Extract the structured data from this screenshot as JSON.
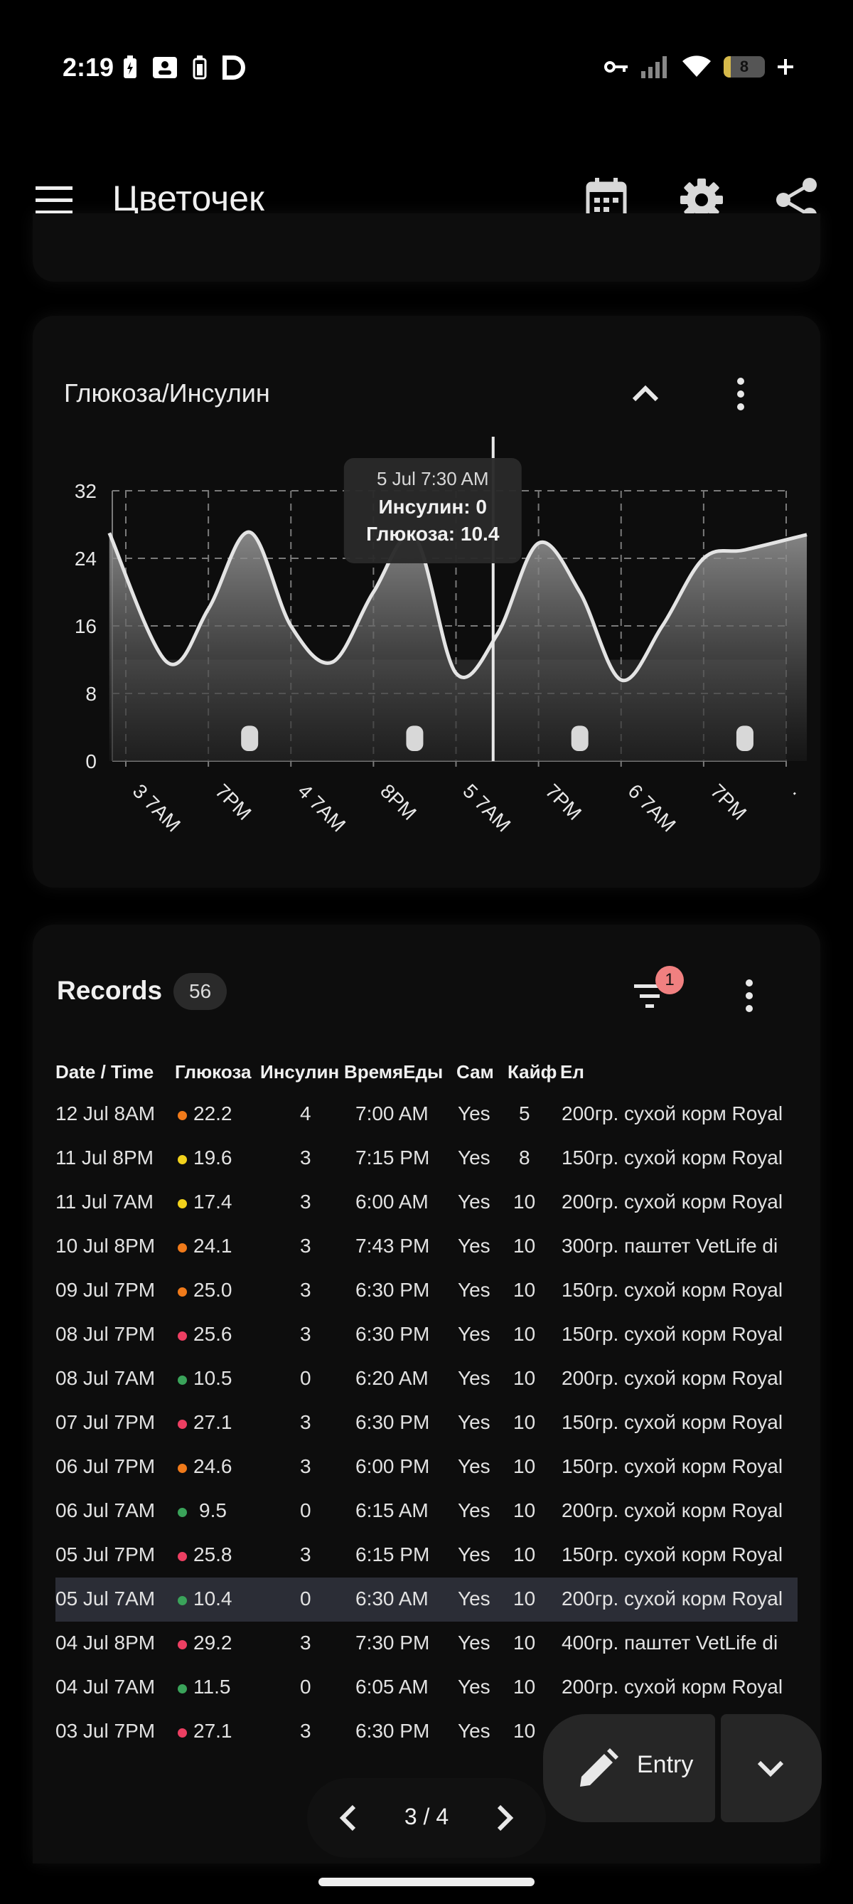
{
  "status": {
    "time": "2:19",
    "battery": "8",
    "battery_level": 0.08
  },
  "appbar": {
    "title": "Цветочек"
  },
  "chart_card": {
    "title": "Глюкоза/Инсулин",
    "tooltip": {
      "date": "5 Jul 7:30 AM",
      "insulin": "Инсулин: 0",
      "glucose": "Глюкоза: 10.4"
    }
  },
  "chart_data": {
    "type": "area",
    "ylim": [
      0,
      32
    ],
    "y_ticks": [
      "0",
      "8",
      "16",
      "24",
      "32"
    ],
    "x_ticks": [
      "3 7AM",
      "7PM",
      "4 7AM",
      "8PM",
      "5 7AM",
      "7PM",
      "6 7AM",
      "7PM",
      "."
    ],
    "x_tick_positions": [
      0,
      1,
      2,
      3,
      4,
      5,
      6,
      7,
      8
    ],
    "xlim": [
      -0.2,
      8.25
    ],
    "target_range": [
      0,
      12
    ],
    "series": [
      {
        "type": "area",
        "x": [
          -0.2,
          0.5,
          1.0,
          1.5,
          2.0,
          2.5,
          3.0,
          3.5,
          4.0,
          4.5,
          5.0,
          5.5,
          6.0,
          6.5,
          7.0,
          7.5,
          8.25
        ],
        "values": [
          27.0,
          11.7,
          18.0,
          27.1,
          16.0,
          11.7,
          20.0,
          26.5,
          10.4,
          15.0,
          25.8,
          20.0,
          9.6,
          16.0,
          24.0,
          25.0,
          26.8
        ]
      },
      {
        "type": "bar",
        "x": [
          1.5,
          3.5,
          5.5,
          7.5
        ],
        "values": [
          3,
          3,
          3,
          3
        ]
      }
    ],
    "cursor_x": 4.45
  },
  "records": {
    "title": "Records",
    "count": "56",
    "filter_badge": "1",
    "columns": [
      "Date / Time",
      "Глюкоза",
      "Инсулин",
      "ВремяЕды",
      "Сам",
      "Кайф",
      "Ел"
    ],
    "rows": [
      {
        "date": "12 Jul 8AM",
        "glucose": "22.2",
        "dot": "#f07a1a",
        "insulin": "4",
        "meal": "7:00 AM",
        "self": "Yes",
        "joy": "5",
        "food": "200гр. сухой корм Royal"
      },
      {
        "date": "11 Jul 8PM",
        "glucose": "19.6",
        "dot": "#f2d21c",
        "insulin": "3",
        "meal": "7:15 PM",
        "self": "Yes",
        "joy": "8",
        "food": "150гр. сухой корм Royal"
      },
      {
        "date": "11 Jul 7AM",
        "glucose": "17.4",
        "dot": "#f2d21c",
        "insulin": "3",
        "meal": "6:00 AM",
        "self": "Yes",
        "joy": "10",
        "food": "200гр. сухой корм Royal"
      },
      {
        "date": "10 Jul 8PM",
        "glucose": "24.1",
        "dot": "#f07a1a",
        "insulin": "3",
        "meal": "7:43 PM",
        "self": "Yes",
        "joy": "10",
        "food": "300гр. паштет VetLife di"
      },
      {
        "date": "09 Jul 7PM",
        "glucose": "25.0",
        "dot": "#f07a1a",
        "insulin": "3",
        "meal": "6:30 PM",
        "self": "Yes",
        "joy": "10",
        "food": "150гр. сухой корм Royal"
      },
      {
        "date": "08 Jul 7PM",
        "glucose": "25.6",
        "dot": "#ec3f62",
        "insulin": "3",
        "meal": "6:30 PM",
        "self": "Yes",
        "joy": "10",
        "food": "150гр. сухой корм Royal"
      },
      {
        "date": "08 Jul 7AM",
        "glucose": "10.5",
        "dot": "#3aa35a",
        "insulin": "0",
        "meal": "6:20 AM",
        "self": "Yes",
        "joy": "10",
        "food": "200гр. сухой корм Royal"
      },
      {
        "date": "07 Jul 7PM",
        "glucose": "27.1",
        "dot": "#ec3f62",
        "insulin": "3",
        "meal": "6:30 PM",
        "self": "Yes",
        "joy": "10",
        "food": "150гр. сухой корм Royal"
      },
      {
        "date": "06 Jul 7PM",
        "glucose": "24.6",
        "dot": "#f07a1a",
        "insulin": "3",
        "meal": "6:00 PM",
        "self": "Yes",
        "joy": "10",
        "food": "150гр. сухой корм Royal"
      },
      {
        "date": "06 Jul 7AM",
        "glucose": "9.5",
        "dot": "#3aa35a",
        "insulin": "0",
        "meal": "6:15 AM",
        "self": "Yes",
        "joy": "10",
        "food": "200гр. сухой корм Royal"
      },
      {
        "date": "05 Jul 7PM",
        "glucose": "25.8",
        "dot": "#ec3f62",
        "insulin": "3",
        "meal": "6:15 PM",
        "self": "Yes",
        "joy": "10",
        "food": "150гр. сухой корм Royal"
      },
      {
        "date": "05 Jul 7AM",
        "glucose": "10.4",
        "dot": "#3aa35a",
        "insulin": "0",
        "meal": "6:30 AM",
        "self": "Yes",
        "joy": "10",
        "food": "200гр. сухой корм Royal",
        "selected": true
      },
      {
        "date": "04 Jul 8PM",
        "glucose": "29.2",
        "dot": "#ec3f62",
        "insulin": "3",
        "meal": "7:30 PM",
        "self": "Yes",
        "joy": "10",
        "food": "400гр. паштет VetLife di"
      },
      {
        "date": "04 Jul 7AM",
        "glucose": "11.5",
        "dot": "#3aa35a",
        "insulin": "0",
        "meal": "6:05 AM",
        "self": "Yes",
        "joy": "10",
        "food": "200гр. сухой корм Royal"
      },
      {
        "date": "03 Jul 7PM",
        "glucose": "27.1",
        "dot": "#ec3f62",
        "insulin": "3",
        "meal": "6:30 PM",
        "self": "Yes",
        "joy": "10",
        "food": ""
      }
    ]
  },
  "fab": {
    "label": "Entry"
  },
  "pager": {
    "text": "3 / 4"
  },
  "icons": {
    "menu": "menu-icon",
    "calendar": "calendar-icon",
    "settings": "gear-icon",
    "share": "share-icon",
    "collapse": "chevron-up-icon",
    "more": "more-vert-icon",
    "filter": "filter-icon",
    "edit": "pencil-icon",
    "dropdown": "chevron-down-icon",
    "prev": "chevron-left-icon",
    "next": "chevron-right-icon"
  }
}
